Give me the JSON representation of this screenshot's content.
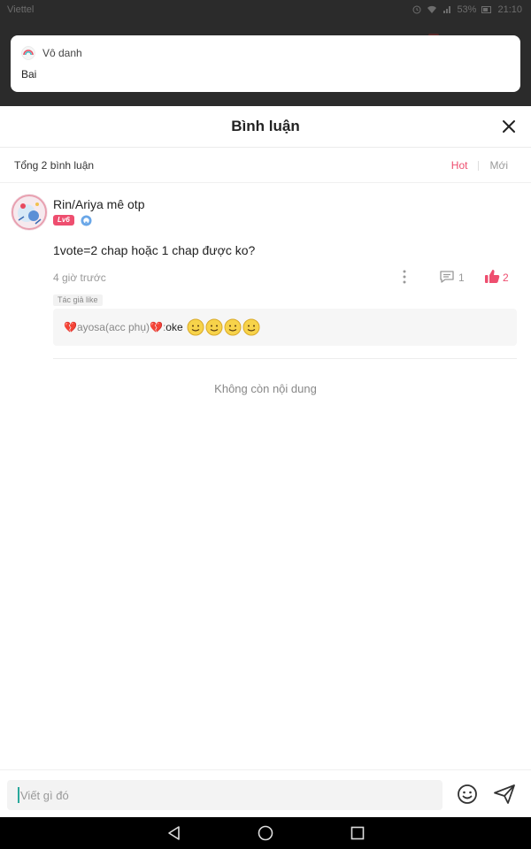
{
  "status_bar": {
    "carrier": "Viettel",
    "battery": "53%",
    "time": "21:10"
  },
  "notification": {
    "sender": "Vô danh",
    "message": "Bai"
  },
  "header": {
    "title": "Bình luận"
  },
  "subheader": {
    "count_label": "Tổng 2 bình luận",
    "sort_hot": "Hot",
    "sort_new": "Mới"
  },
  "comment": {
    "username": "Rin/Ariya mê otp",
    "level": "Lv6",
    "text": "1vote=2 chap hoặc 1 chap được ko?",
    "time": "4 giờ trước",
    "reply_count": "1",
    "like_count": "2",
    "author_like": "Tác giả like",
    "reply": {
      "username": "ayosa(acc phụ)",
      "separator": " : ",
      "text": "oke"
    }
  },
  "no_more": "Không còn nội dung",
  "input": {
    "placeholder": "Viết gì đó"
  },
  "colors": {
    "accent": "#ee4e6f",
    "caret": "#2aa89c"
  }
}
